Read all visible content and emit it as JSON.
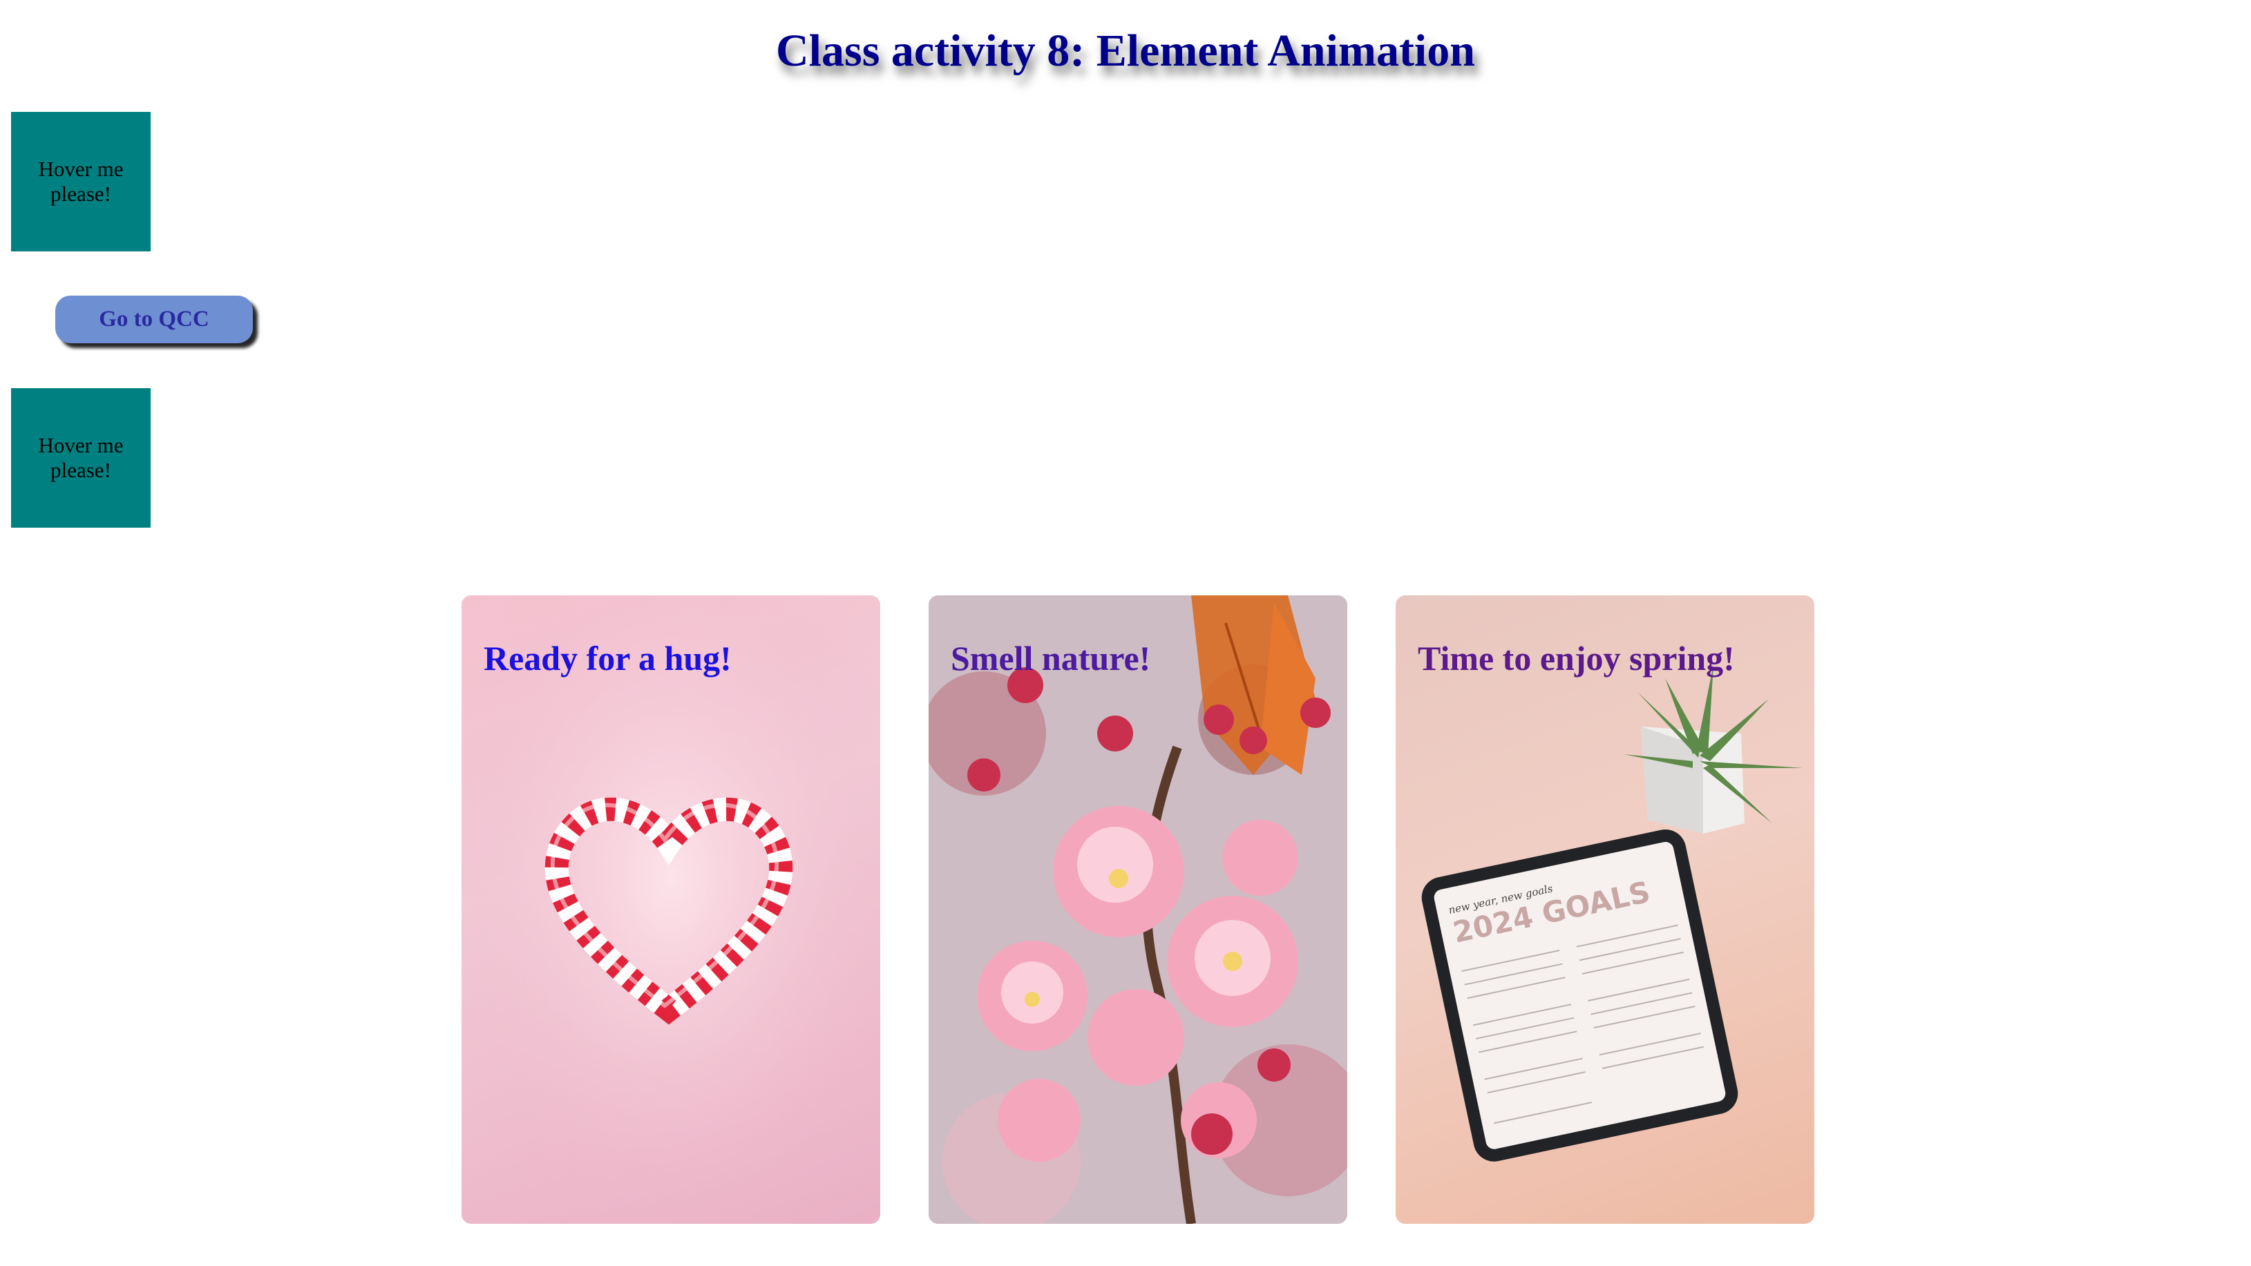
{
  "page": {
    "title": "Class activity 8: Element Animation"
  },
  "hover_boxes": [
    {
      "label": "Hover me please!"
    },
    {
      "label": "Hover me please!"
    }
  ],
  "button": {
    "label": "Go to QCC"
  },
  "cards": [
    {
      "title": "Ready for a hug!",
      "image": "candy-cane-heart"
    },
    {
      "title": "Smell nature!",
      "image": "cherry-blossom"
    },
    {
      "title": "Time to enjoy spring!",
      "image": "tablet-goals-plant"
    }
  ],
  "tablet_screen": {
    "heading": "2024 GOALS",
    "script": "new year, new goals"
  },
  "colors": {
    "title": "#00008b",
    "hover_box": "#008080",
    "button": "#6e8fd1"
  }
}
